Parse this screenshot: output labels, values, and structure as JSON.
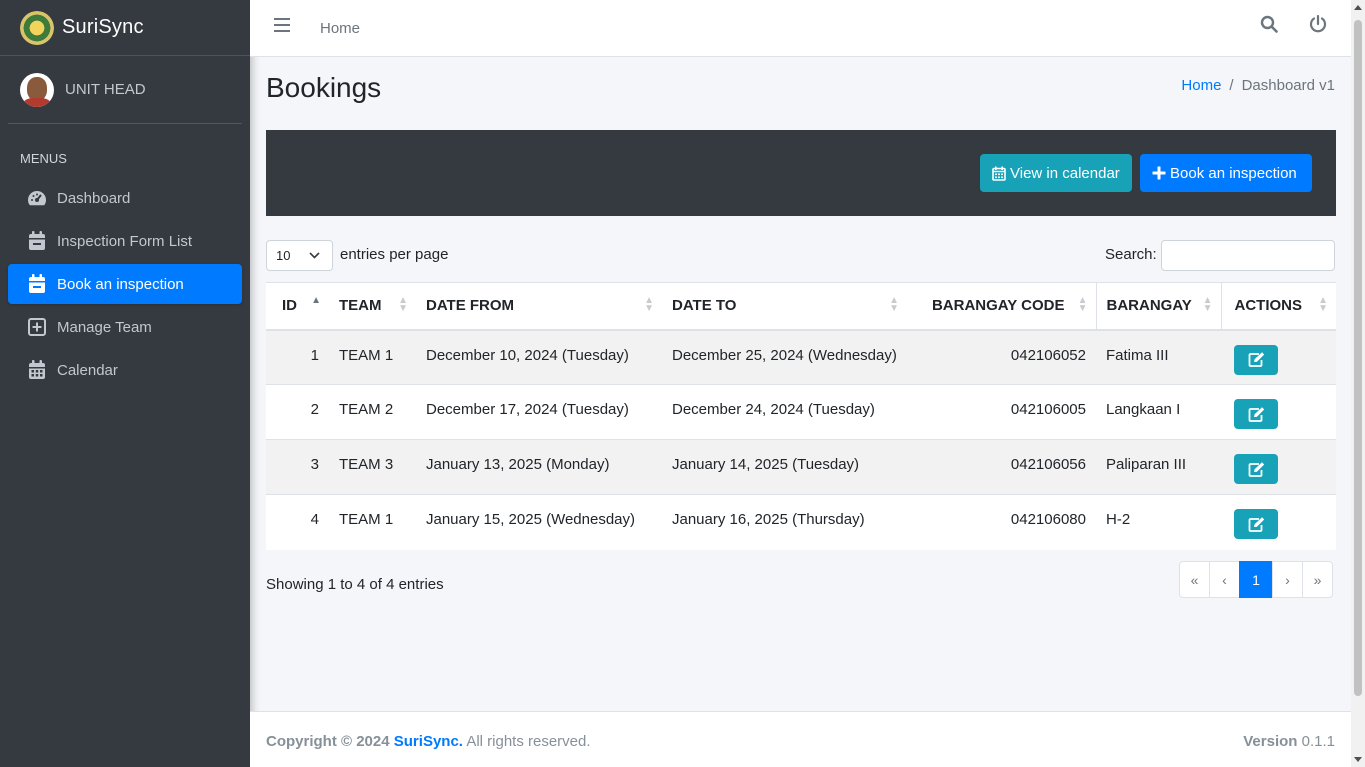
{
  "brand": {
    "name_bold": "Suri",
    "name_light": "Sync"
  },
  "user": {
    "name": "UNIT HEAD"
  },
  "sidebar": {
    "header": "MENUS",
    "items": [
      {
        "label": "Dashboard",
        "icon": "tachometer-icon"
      },
      {
        "label": "Inspection Form List",
        "icon": "calendar-minus-icon"
      },
      {
        "label": "Book an inspection",
        "icon": "calendar-minus-icon",
        "active": true
      },
      {
        "label": "Manage Team",
        "icon": "plus-square-icon"
      },
      {
        "label": "Calendar",
        "icon": "calendar-icon"
      }
    ]
  },
  "topbar": {
    "home_label": "Home"
  },
  "page": {
    "title": "Bookings",
    "breadcrumb": [
      "Home",
      "/",
      "Dashboard v1"
    ]
  },
  "actions": {
    "view_calendar": "View in calendar",
    "book_inspection": "Book an inspection"
  },
  "table_controls": {
    "length_value": "10",
    "length_label": "entries per page",
    "search_label": "Search:",
    "search_value": ""
  },
  "table": {
    "columns": [
      "ID",
      "TEAM",
      "DATE FROM",
      "DATE TO",
      "BARANGAY CODE",
      "BARANGAY",
      "ACTIONS"
    ],
    "rows": [
      {
        "id": "1",
        "team": "TEAM 1",
        "date_from": "December 10, 2024 (Tuesday)",
        "date_to": "December 25, 2024 (Wednesday)",
        "code": "042106052",
        "barangay": "Fatima III"
      },
      {
        "id": "2",
        "team": "TEAM 2",
        "date_from": "December 17, 2024 (Tuesday)",
        "date_to": "December 24, 2024 (Tuesday)",
        "code": "042106005",
        "barangay": "Langkaan I"
      },
      {
        "id": "3",
        "team": "TEAM 3",
        "date_from": "January 13, 2025 (Monday)",
        "date_to": "January 14, 2025 (Tuesday)",
        "code": "042106056",
        "barangay": "Paliparan III"
      },
      {
        "id": "4",
        "team": "TEAM 1",
        "date_from": "January 15, 2025 (Wednesday)",
        "date_to": "January 16, 2025 (Thursday)",
        "code": "042106080",
        "barangay": "H-2"
      }
    ]
  },
  "table_info": "Showing 1 to 4 of 4 entries",
  "pagination": {
    "first": "«",
    "prev": "‹",
    "current": "1",
    "next": "›",
    "last": "»"
  },
  "footer": {
    "copyright": "Copyright © 2024",
    "brand": "SuriSync.",
    "rights": "All rights reserved.",
    "version_label": "Version",
    "version": "0.1.1"
  },
  "colors": {
    "primary": "#007bff",
    "info": "#17a2b8",
    "sidebar": "#343a40"
  }
}
